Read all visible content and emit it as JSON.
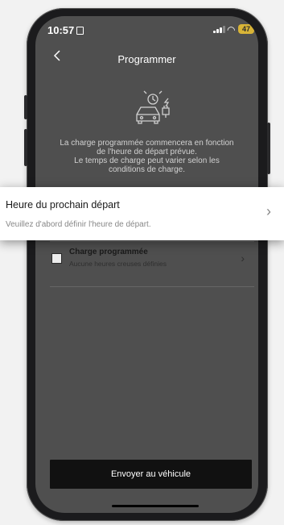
{
  "status_bar": {
    "time": "10:57",
    "battery": "47"
  },
  "header": {
    "back_icon": "chevron-left-icon",
    "title": "Programmer"
  },
  "illustration": {
    "icon": "car-charging-clock-icon"
  },
  "info_text": [
    "La charge programmée commencera en fonction",
    "de l'heure de départ prévue.",
    "Le temps de charge peut varier selon les",
    "conditions de charge."
  ],
  "departure": {
    "title": "Heure du prochain départ",
    "subtitle": "Veuillez d'abord définir l'heure de départ."
  },
  "scheduled_charge": {
    "title": "Charge programmée",
    "subtitle": "Aucune heures creuses définies",
    "checked": false
  },
  "send_button": {
    "label": "Envoyer au véhicule"
  },
  "colors": {
    "overlay": "#4f4f4f",
    "button": "#111111",
    "battery": "#d8b437"
  }
}
